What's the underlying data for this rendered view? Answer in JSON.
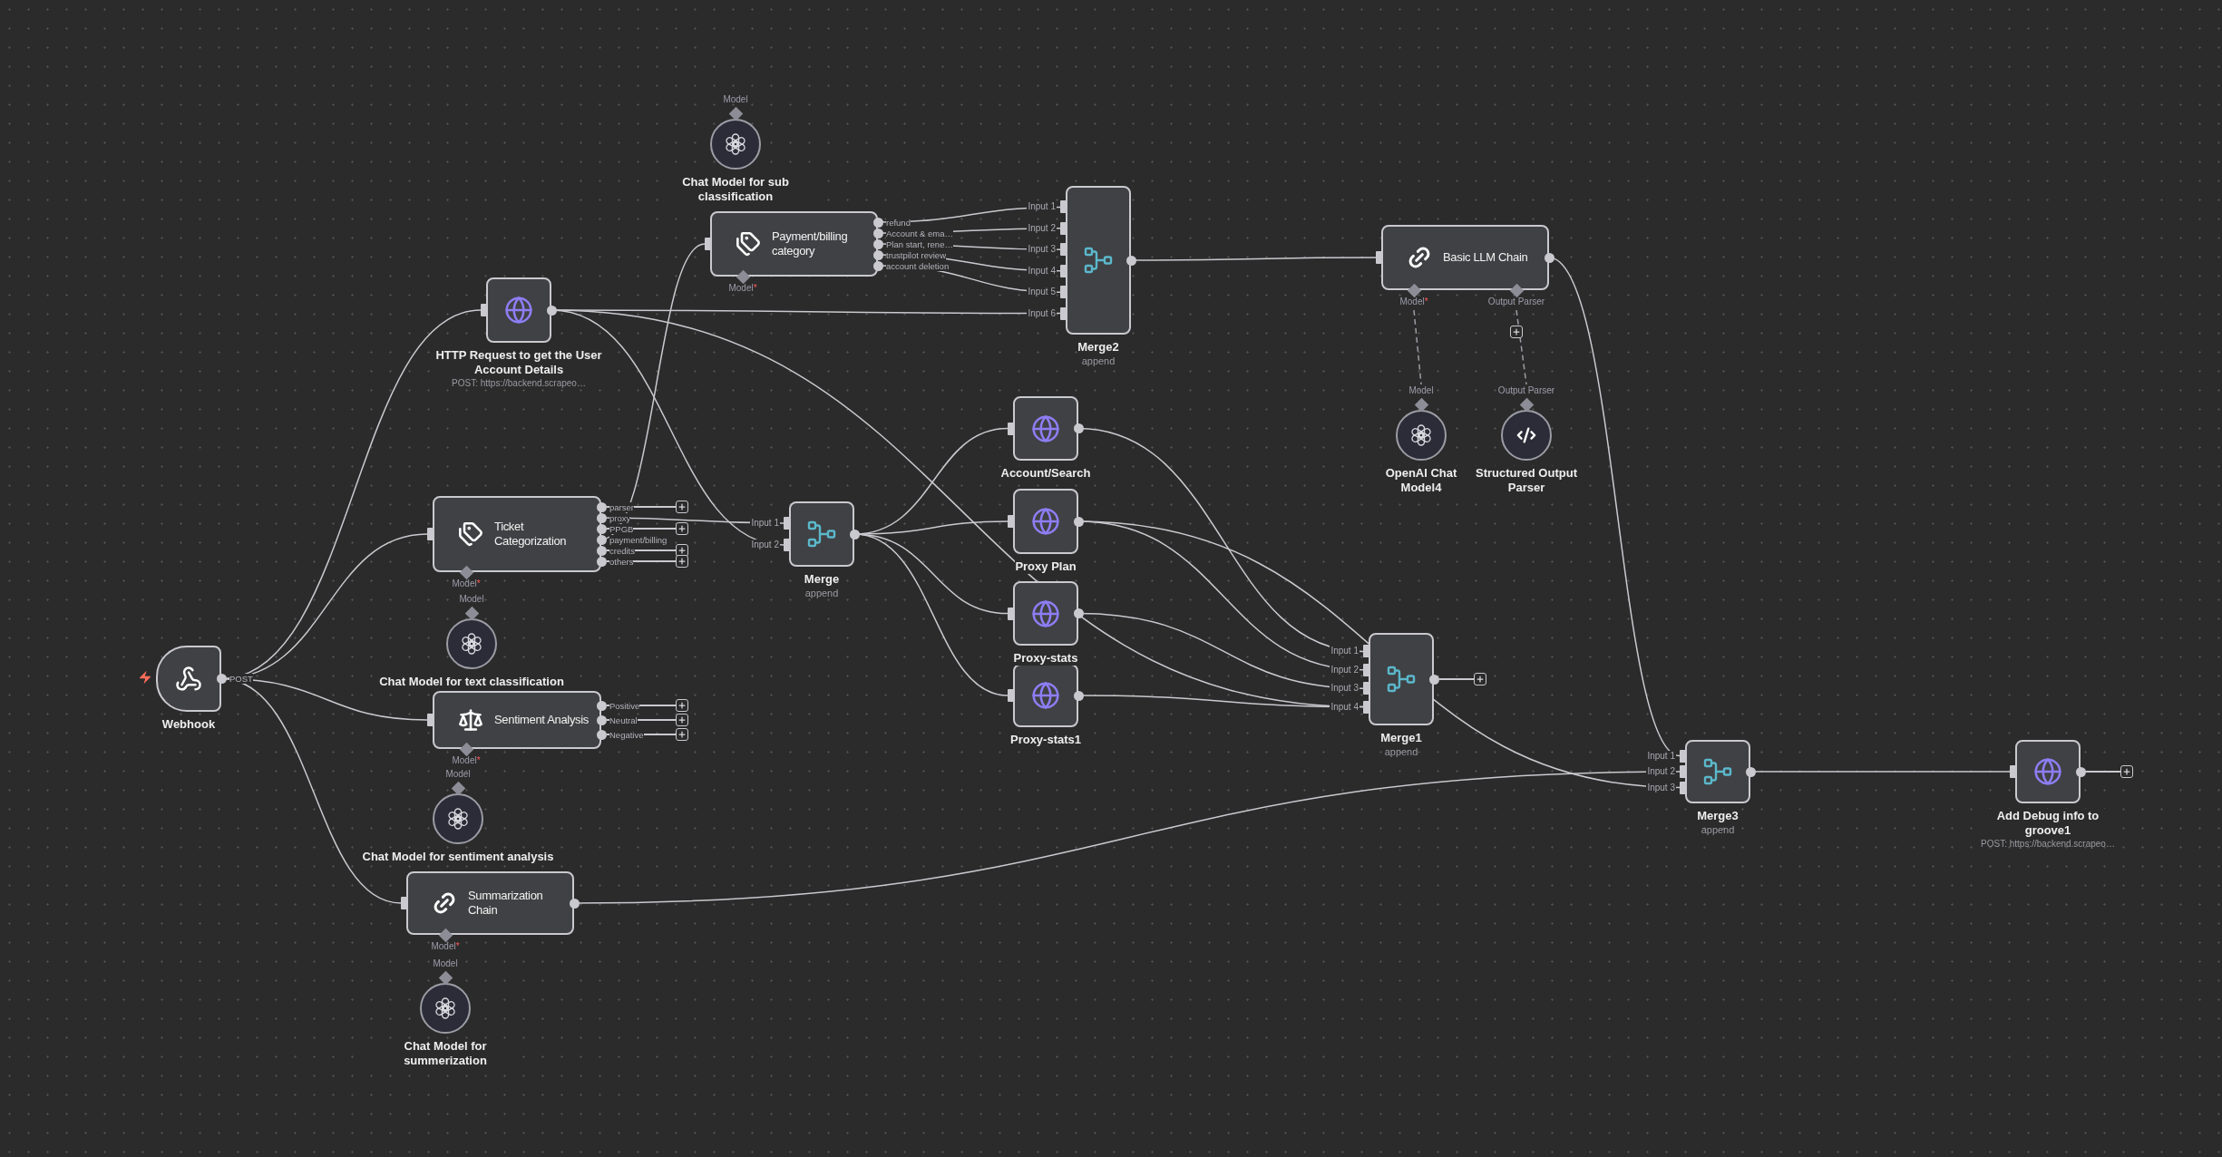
{
  "canvas": {
    "nodes": [
      {
        "kind": "trigger",
        "label": "Webhook",
        "outputs": [
          {
            "label": "POST"
          }
        ]
      },
      {
        "kind": "square",
        "label": "HTTP Request to get the User Account Details",
        "subtitle": "POST: https://backend.scrapeo…"
      },
      {
        "kind": "wide",
        "label": "Ticket Categorization",
        "outputs": [
          {
            "label": "parser",
            "add_button": true
          },
          {
            "label": "proxy"
          },
          {
            "label": "PPGB",
            "add_button": true
          },
          {
            "label": "payment/billing"
          },
          {
            "label": "credits",
            "add_button": true
          },
          {
            "label": "others",
            "add_button": true
          }
        ],
        "sub_ports": [
          {
            "label": "Model",
            "mark": "*"
          }
        ]
      },
      {
        "kind": "model",
        "label": "Chat Model for text classification",
        "port_label": "Model"
      },
      {
        "kind": "wide",
        "label": "Sentiment Analysis",
        "outputs": [
          {
            "label": "Positive",
            "add_button": true
          },
          {
            "label": "Neutral",
            "add_button": true
          },
          {
            "label": "Negative",
            "add_button": true
          }
        ],
        "sub_ports": [
          {
            "label": "Model",
            "mark": "*"
          }
        ]
      },
      {
        "kind": "model",
        "label": "Chat Model for sentiment analysis",
        "port_label": "Model"
      },
      {
        "kind": "wide",
        "label": "Summarization Chain",
        "sub_ports": [
          {
            "label": "Model",
            "mark": "*"
          }
        ]
      },
      {
        "kind": "model",
        "label": "Chat Model for summerization",
        "port_label": "Model"
      },
      {
        "kind": "model",
        "label": "Chat Model for sub classification",
        "port_label": "Model"
      },
      {
        "kind": "wide",
        "label": "Payment/billing category",
        "outputs": [
          {
            "label": "refund"
          },
          {
            "label": "Account & ema…"
          },
          {
            "label": "Plan start, rene…"
          },
          {
            "label": "trustpilot review"
          },
          {
            "label": "account deletion"
          }
        ],
        "sub_ports": [
          {
            "label": "Model",
            "mark": "*"
          }
        ]
      },
      {
        "kind": "merge",
        "label": "Merge2",
        "subtitle": "append",
        "inputs": [
          "Input 1",
          "Input 2",
          "Input 3",
          "Input 4",
          "Input 5",
          "Input 6"
        ]
      },
      {
        "kind": "merge",
        "label": "Merge",
        "subtitle": "append",
        "inputs": [
          "Input 1",
          "Input 2"
        ]
      },
      {
        "kind": "square",
        "label": "Account/Search"
      },
      {
        "kind": "square",
        "label": "Proxy Plan"
      },
      {
        "kind": "square",
        "label": "Proxy-stats"
      },
      {
        "kind": "square",
        "label": "Proxy-stats1"
      },
      {
        "kind": "merge",
        "label": "Merge1",
        "subtitle": "append",
        "inputs": [
          "Input 1",
          "Input 2",
          "Input 3",
          "Input 4"
        ],
        "add_button": true
      },
      {
        "kind": "wide",
        "label": "Basic LLM Chain",
        "sub_ports": [
          {
            "label": "Model",
            "mark": "*"
          },
          {
            "label": "Output Parser",
            "add_button": true
          }
        ]
      },
      {
        "kind": "model",
        "label": "OpenAI Chat Model4",
        "port_label": "Model"
      },
      {
        "kind": "model",
        "label": "Structured Output Parser",
        "port_label": "Output Parser"
      },
      {
        "kind": "merge",
        "label": "Merge3",
        "subtitle": "append",
        "inputs": [
          "Input 1",
          "Input 2",
          "Input 3"
        ]
      },
      {
        "kind": "square",
        "label": "Add Debug info to groove1",
        "subtitle": "POST: https://backend.scrapeo…",
        "add_button": true
      }
    ]
  }
}
